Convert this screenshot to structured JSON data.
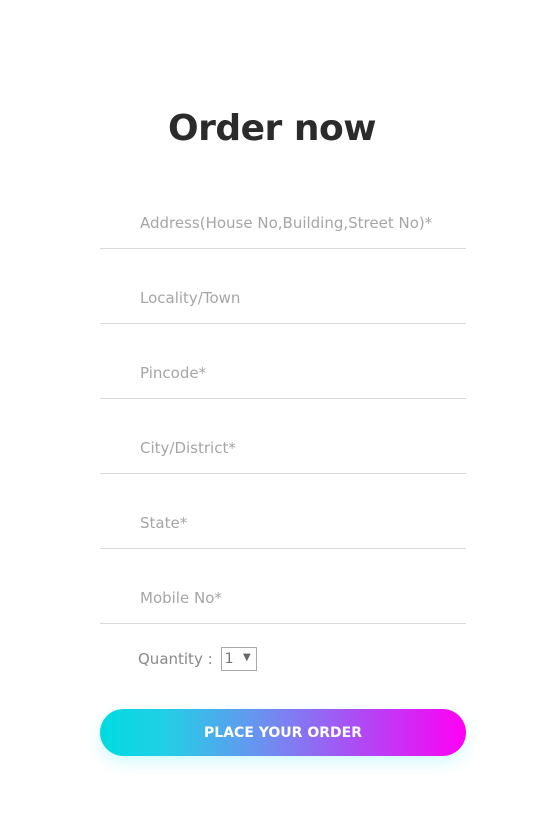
{
  "form": {
    "title": "Order now",
    "fields": [
      {
        "name": "address",
        "placeholder": "Address(House No,Building,Street No)*",
        "value": ""
      },
      {
        "name": "locality",
        "placeholder": "Locality/Town",
        "value": ""
      },
      {
        "name": "pincode",
        "placeholder": "Pincode*",
        "value": ""
      },
      {
        "name": "city",
        "placeholder": "City/District*",
        "value": ""
      },
      {
        "name": "state",
        "placeholder": "State*",
        "value": ""
      },
      {
        "name": "mobile",
        "placeholder": "Mobile No*",
        "value": ""
      }
    ],
    "quantity": {
      "label": "Quantity :",
      "selected": "1",
      "arrow": "▼"
    },
    "submit_label": "PLACE YOUR ORDER"
  },
  "colors": {
    "title": "#2b2b2b",
    "placeholder": "#a6a6a6",
    "underline": "#d9d9d9",
    "button_gradient_start": "#00dbe0",
    "button_gradient_end": "#ff00f5"
  },
  "icons": {
    "quantity_dropdown": "chevron-down-icon"
  }
}
